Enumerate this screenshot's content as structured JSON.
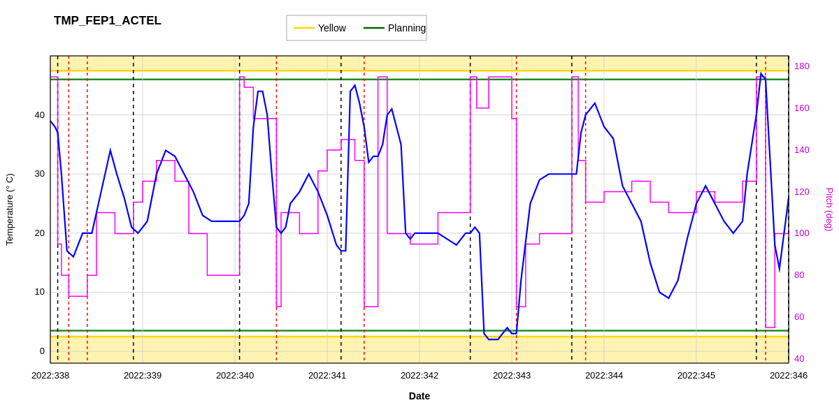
{
  "chart": {
    "title": "TMP_FEP1_ACTEL",
    "x_label": "Date",
    "y_left_label": "Temperature (° C)",
    "y_right_label": "Pitch (deg)",
    "legend": [
      {
        "label": "Yellow",
        "color": "#FFD700",
        "line": "solid"
      },
      {
        "label": "Planning",
        "color": "#006400",
        "line": "solid"
      }
    ],
    "x_ticks": [
      "2022:338",
      "2022:339",
      "2022:340",
      "2022:341",
      "2022:342",
      "2022:343",
      "2022:344",
      "2022:345",
      "2022:346"
    ],
    "y_left_ticks": [
      0,
      10,
      20,
      30,
      40
    ],
    "y_right_ticks": [
      40,
      60,
      80,
      100,
      120,
      140,
      160,
      180
    ],
    "yellow_line_y": 47.5,
    "planning_line_y": 47.5,
    "yellow_lower_y": 2.5,
    "planning_lower_y": 2.5,
    "colors": {
      "blue_line": "#0000FF",
      "magenta_line": "#FF00FF",
      "yellow_band": "#FFD700",
      "green_band": "#228B22",
      "black_dashed": "#000000",
      "red_dashed": "#FF0000",
      "grid": "#CCCCCC",
      "background": "#FFFFFF"
    }
  }
}
